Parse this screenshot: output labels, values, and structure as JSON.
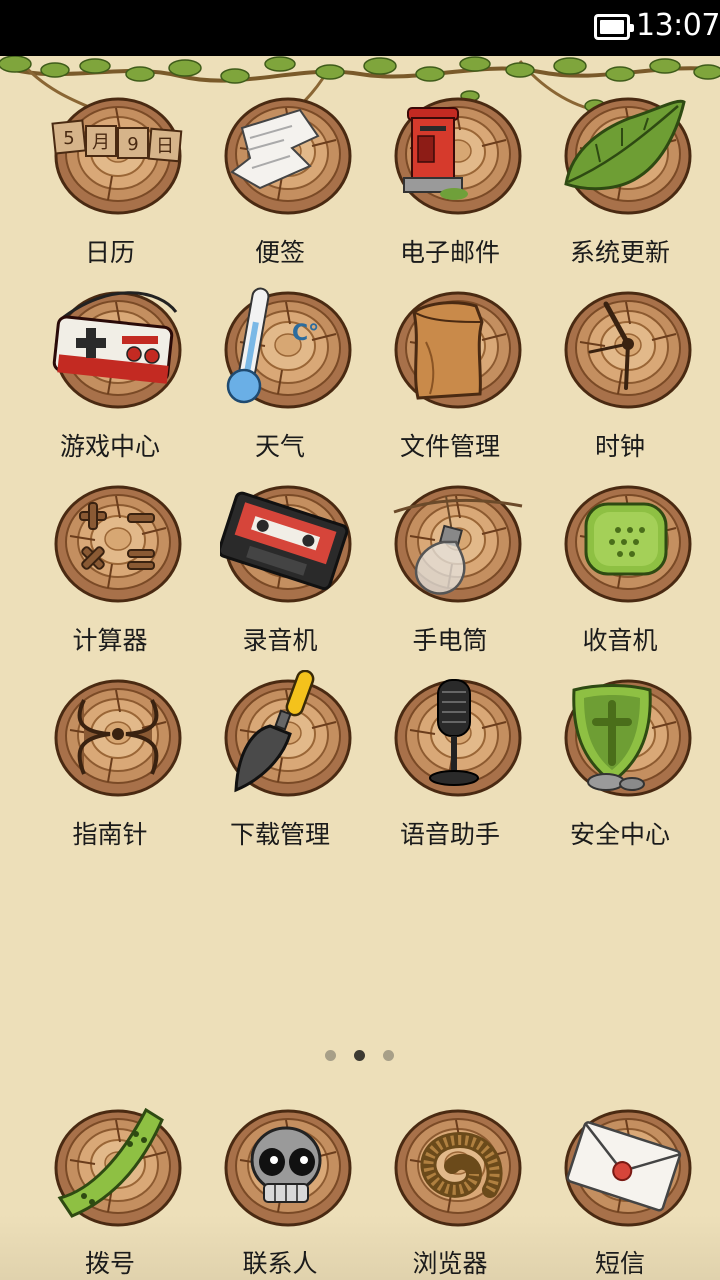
{
  "status_bar": {
    "time": "13:07",
    "battery_icon": "battery-full-icon"
  },
  "apps": [
    {
      "label": "日历",
      "icon": "calendar-icon",
      "date_parts": [
        "5",
        "月",
        "9",
        "日"
      ]
    },
    {
      "label": "便签",
      "icon": "note-paper-icon"
    },
    {
      "label": "电子邮件",
      "icon": "mailbox-icon"
    },
    {
      "label": "系统更新",
      "icon": "leaf-icon"
    },
    {
      "label": "游戏中心",
      "icon": "gamepad-icon"
    },
    {
      "label": "天气",
      "icon": "thermometer-icon",
      "unit": "C°"
    },
    {
      "label": "文件管理",
      "icon": "paper-bag-icon"
    },
    {
      "label": "时钟",
      "icon": "clock-icon"
    },
    {
      "label": "计算器",
      "icon": "calculator-icon"
    },
    {
      "label": "录音机",
      "icon": "cassette-icon"
    },
    {
      "label": "手电筒",
      "icon": "lightbulb-icon"
    },
    {
      "label": "收音机",
      "icon": "radio-speaker-icon"
    },
    {
      "label": "指南针",
      "icon": "compass-icon"
    },
    {
      "label": "下载管理",
      "icon": "trowel-icon"
    },
    {
      "label": "语音助手",
      "icon": "microphone-icon"
    },
    {
      "label": "安全中心",
      "icon": "shield-icon"
    }
  ],
  "pager": {
    "pages": 3,
    "active_index": 1
  },
  "dock": [
    {
      "label": "拨号",
      "icon": "phone-handset-icon"
    },
    {
      "label": "联系人",
      "icon": "skull-contacts-icon"
    },
    {
      "label": "浏览器",
      "icon": "millipede-browser-icon"
    },
    {
      "label": "短信",
      "icon": "envelope-icon"
    }
  ],
  "colors": {
    "background": "#eddfb9",
    "wood": "#a8714a",
    "wood_dark": "#5a3418",
    "wood_light": "#e2b98a",
    "label": "#1b1b1b",
    "vine": "#7fa53c"
  }
}
